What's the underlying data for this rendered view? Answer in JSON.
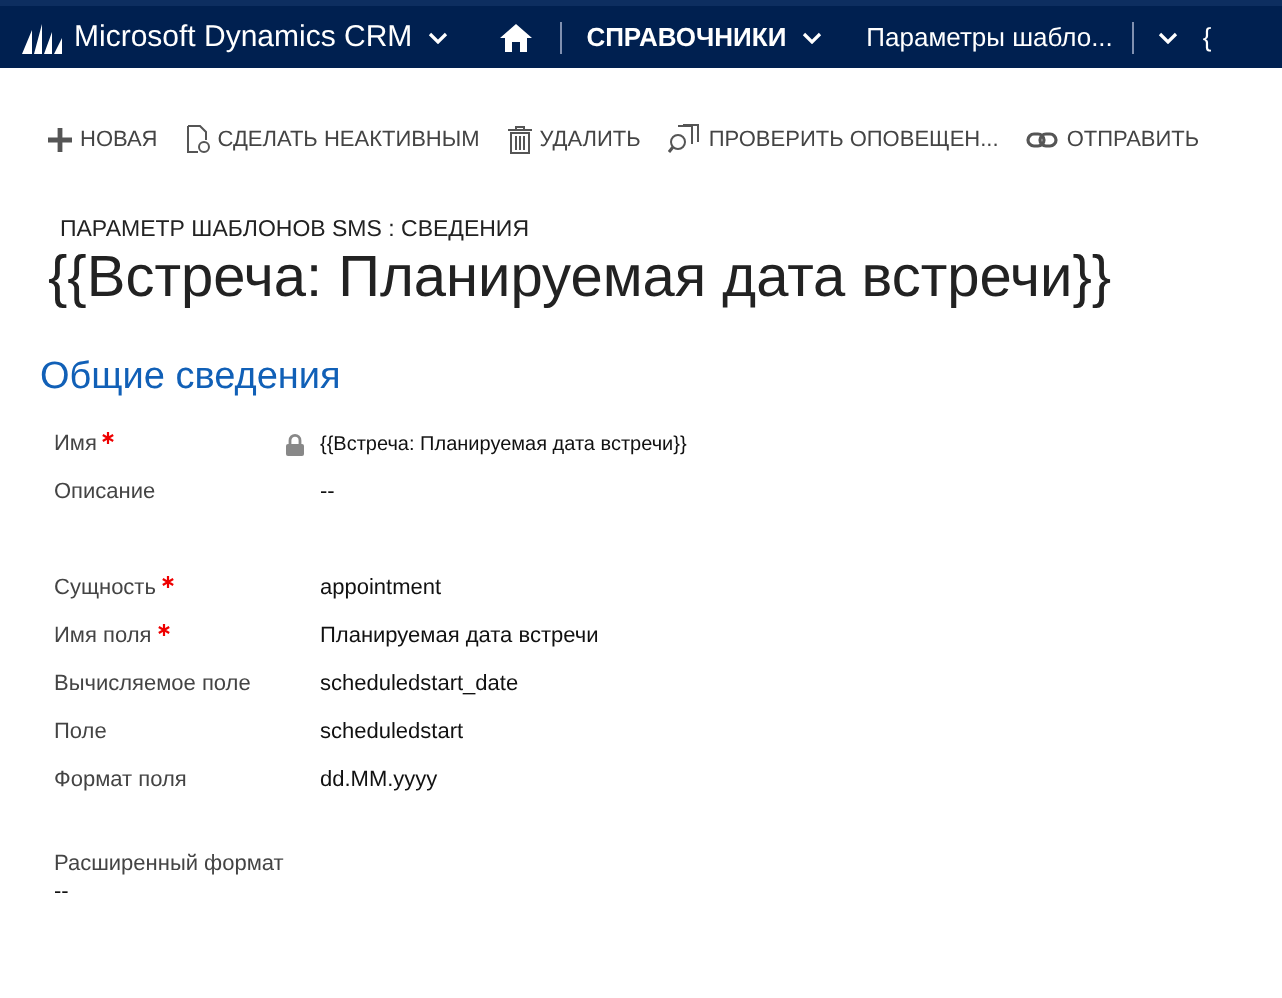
{
  "navbar": {
    "app_title": "Microsoft Dynamics CRM",
    "area": "СПРАВОЧНИКИ",
    "entity": "Параметры шабло...",
    "next": "{"
  },
  "toolbar": [
    {
      "kind": "new",
      "label": "НОВАЯ"
    },
    {
      "kind": "deactivate",
      "label": "СДЕЛАТЬ НЕАКТИВНЫМ"
    },
    {
      "kind": "delete",
      "label": "УДАЛИТЬ"
    },
    {
      "kind": "check",
      "label": "ПРОВЕРИТЬ ОПОВЕЩЕН..."
    },
    {
      "kind": "send",
      "label": "ОТПРАВИТЬ"
    }
  ],
  "record": {
    "breadcrumb": "ПАРАМЕТР ШАБЛОНОВ SMS : СВЕДЕНИЯ",
    "title": "{{Встреча: Планируемая дата встречи}}"
  },
  "section": {
    "title": "Общие сведения",
    "groups": [
      [
        {
          "kind": "inline",
          "label": "Имя",
          "required": true,
          "locked": true,
          "value": "{{Встреча: Планируемая дата встречи}}"
        },
        {
          "kind": "inline",
          "label": "Описание",
          "required": false,
          "locked": false,
          "value": "--"
        }
      ],
      [
        {
          "kind": "inline",
          "label": "Сущность",
          "required": true,
          "locked": false,
          "value": "appointment"
        },
        {
          "kind": "inline",
          "label": "Имя поля",
          "required": true,
          "locked": false,
          "value": "Планируемая дата встречи"
        },
        {
          "kind": "inline",
          "label": "Вычисляемое поле",
          "required": false,
          "locked": false,
          "value": "scheduledstart_date"
        },
        {
          "kind": "inline",
          "label": "Поле",
          "required": false,
          "locked": false,
          "value": "scheduledstart"
        },
        {
          "kind": "inline",
          "label": "Формат поля",
          "required": false,
          "locked": false,
          "value": "dd.MM.yyyy"
        }
      ],
      [
        {
          "kind": "stacked",
          "label": "Расширенный формат",
          "required": false,
          "locked": false,
          "value": "--"
        }
      ]
    ]
  }
}
